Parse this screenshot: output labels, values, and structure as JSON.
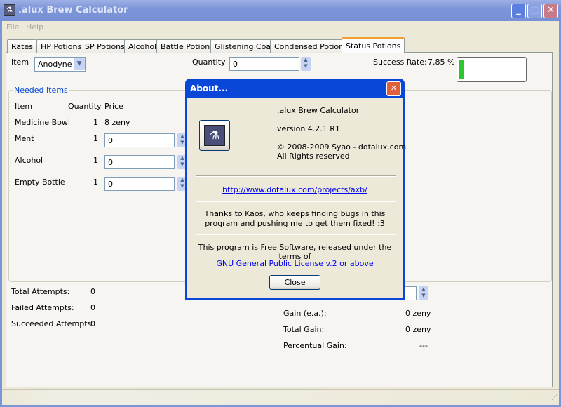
{
  "window": {
    "title": ".alux Brew Calculator",
    "icon": "alux-app-icon"
  },
  "menu": [
    "File",
    "Help"
  ],
  "tabs": [
    "Rates",
    "HP Potions",
    "SP Potions",
    "Alcohol",
    "Battle Potions",
    "Glistening Coat",
    "Condensed Potions",
    "Status Potions"
  ],
  "active_tab": "Status Potions",
  "form": {
    "item_label": "Item",
    "item_value": "Anodyne",
    "quantity_label": "Quantity",
    "quantity_value": "0",
    "success_rate_label": "Success Rate:",
    "success_rate_value": "7.85 %",
    "success_rate_fraction": 0.0785,
    "progress_color": "#2ec52e"
  },
  "needed": {
    "title": "Needed Items",
    "headers": [
      "Item",
      "Quantity",
      "Price"
    ],
    "rows": [
      {
        "item": "Medicine Bowl",
        "qty": "1",
        "price": "8 zeny"
      },
      {
        "item": "Ment",
        "qty": "1",
        "price": "0"
      },
      {
        "item": "Alcohol",
        "qty": "1",
        "price": "0"
      },
      {
        "item": "Empty Bottle",
        "qty": "1",
        "price": "0"
      }
    ]
  },
  "stats": {
    "total_label": "Total Attempts:",
    "total": "0",
    "failed_label": "Failed Attempts:",
    "failed": "0",
    "succeeded_label": "Succeeded Attempts:",
    "succeeded": "0",
    "gain_ea_label": "Gain (e.a.):",
    "gain_ea": "0 zeny",
    "total_gain_label": "Total Gain:",
    "total_gain": "0 zeny",
    "percentual_label": "Percentual Gain:",
    "percentual": "---"
  },
  "about": {
    "title": "About...",
    "app": ".alux Brew Calculator",
    "version": "version 4.2.1 R1",
    "copyright": "© 2008-2009 Syao - dotalux.com",
    "rights": "All Rights reserved",
    "url": "http://www.dotalux.com/projects/axb/",
    "thanks": "Thanks to Kaos, who keeps finding bugs in this program and pushing me to get them fixed! :3",
    "license_text": "This program is Free Software, released under the terms of",
    "license_link": "GNU General Public License v.2 or above",
    "close": "Close"
  }
}
